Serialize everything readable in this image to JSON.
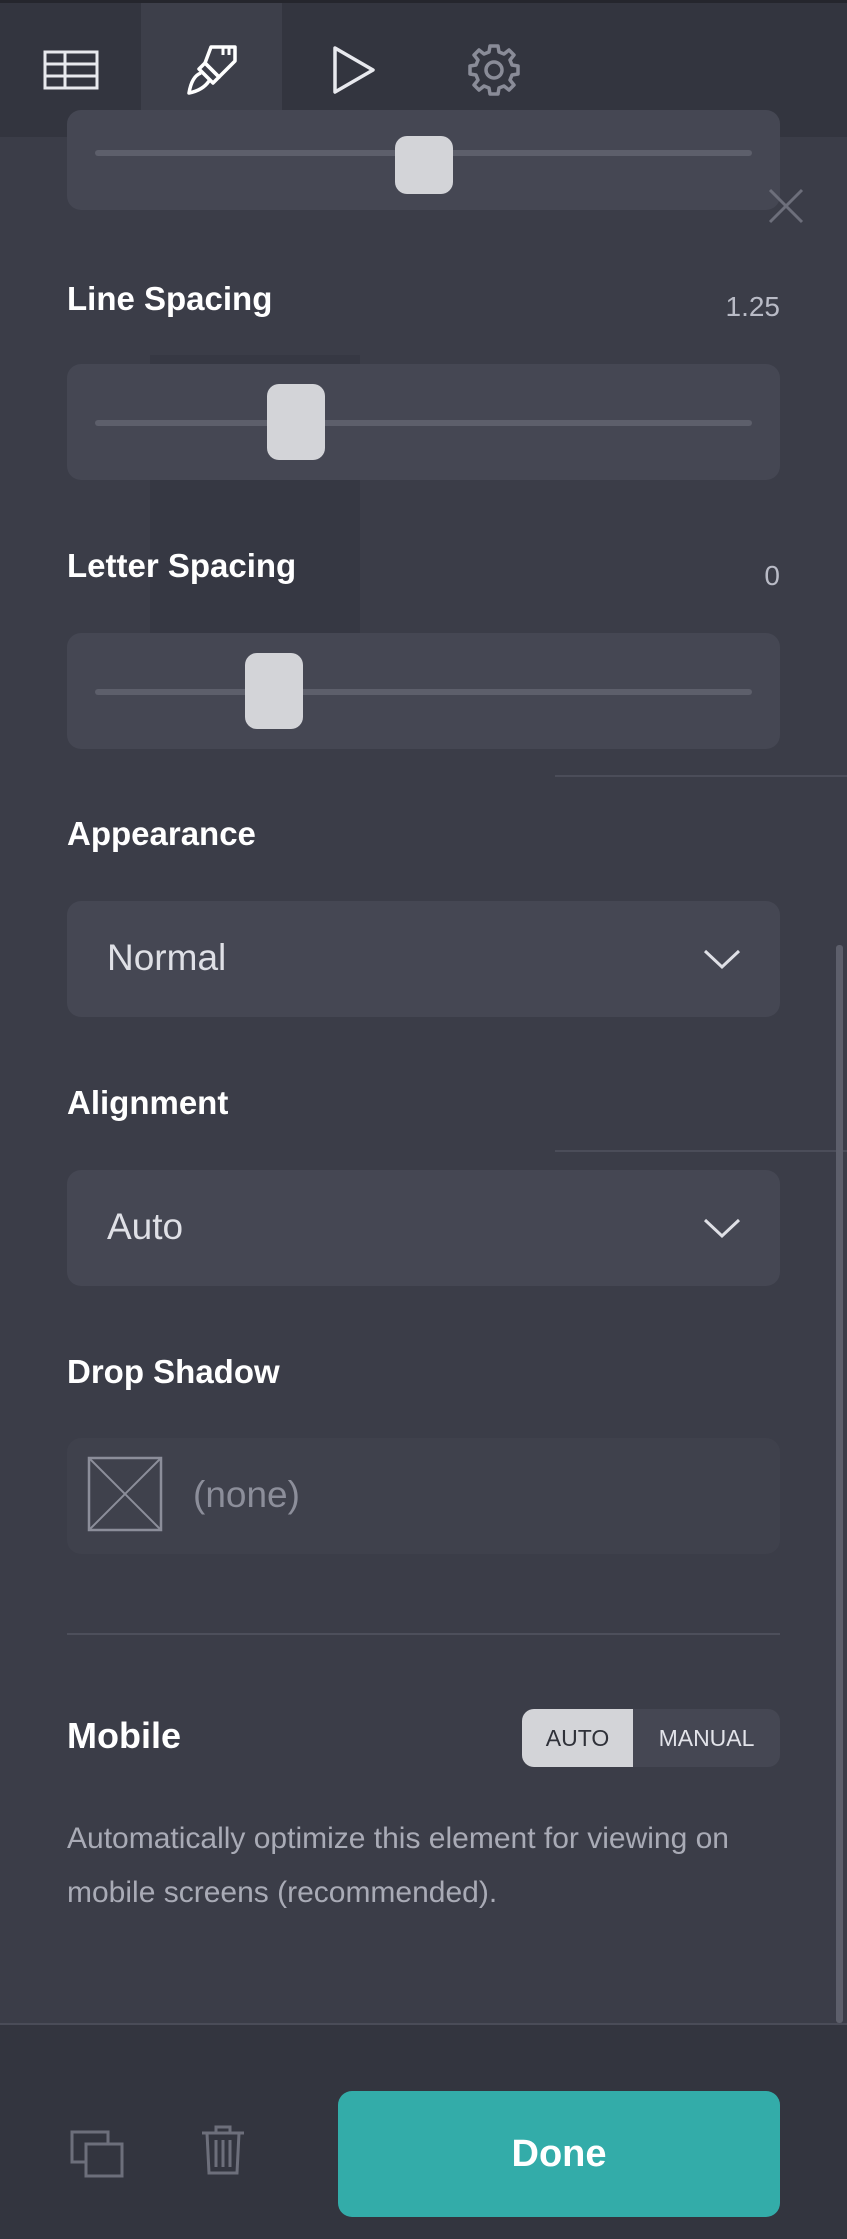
{
  "toolbar": {
    "tabs": [
      {
        "name": "table-icon",
        "active": false
      },
      {
        "name": "brush-icon",
        "active": true
      },
      {
        "name": "play-icon",
        "active": false
      },
      {
        "name": "gear-icon",
        "active": false
      }
    ]
  },
  "settings": {
    "line_spacing": {
      "label": "Line Spacing",
      "value": "1.25",
      "level": 0.27
    },
    "letter_spacing": {
      "label": "Letter Spacing",
      "value": "0",
      "level": 0.25
    },
    "top_slider_level": 0.5,
    "appearance": {
      "label": "Appearance",
      "selected": "Normal"
    },
    "alignment": {
      "label": "Alignment",
      "selected": "Auto"
    },
    "drop_shadow": {
      "label": "Drop Shadow",
      "selected": "(none)"
    },
    "mobile": {
      "label": "Mobile",
      "options": [
        "AUTO",
        "MANUAL"
      ],
      "selected": "AUTO",
      "description": "Automatically optimize this element for viewing on mobile screens (recommended)."
    }
  },
  "footer": {
    "done_label": "Done"
  },
  "colors": {
    "accent": "#33aca9",
    "panel": "#3b3d48",
    "toolbar": "#33353f"
  }
}
